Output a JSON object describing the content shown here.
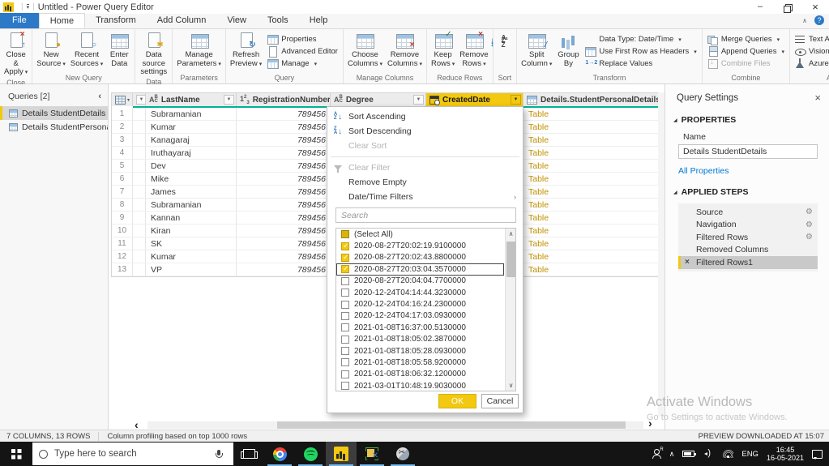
{
  "colors": {
    "accent": "#f2c811",
    "file_tab_blue": "#2b79c7",
    "quality_bar_teal": "#00b394",
    "table_value_amber": "#bf9000",
    "link_blue": "#0078d4"
  },
  "title_bar": {
    "title": "Untitled - Power Query Editor",
    "window_controls": [
      "minimize",
      "maximize",
      "close"
    ]
  },
  "tabs": [
    {
      "label": "File",
      "file": true
    },
    {
      "label": "Home",
      "active": true
    },
    {
      "label": "Transform"
    },
    {
      "label": "Add Column"
    },
    {
      "label": "View"
    },
    {
      "label": "Tools"
    },
    {
      "label": "Help"
    }
  ],
  "ribbon": {
    "groups": [
      {
        "label": "Close",
        "big": [
          {
            "label": "Close &\nApply",
            "icon": "close-apply",
            "dropdown": true
          }
        ]
      },
      {
        "label": "New Query",
        "big": [
          {
            "label": "New\nSource",
            "icon": "new-source",
            "dropdown": true
          },
          {
            "label": "Recent\nSources",
            "icon": "recent-sources",
            "dropdown": true
          },
          {
            "label": "Enter\nData",
            "icon": "enter-data"
          }
        ]
      },
      {
        "label": "Data Sources",
        "big": [
          {
            "label": "Data source\nsettings",
            "icon": "data-source-settings"
          }
        ]
      },
      {
        "label": "Parameters",
        "big": [
          {
            "label": "Manage\nParameters",
            "icon": "manage-parameters",
            "dropdown": true
          }
        ]
      },
      {
        "label": "Query",
        "big": [
          {
            "label": "Refresh\nPreview",
            "icon": "refresh-preview",
            "dropdown": true
          }
        ],
        "small": [
          {
            "label": "Properties",
            "icon": "properties"
          },
          {
            "label": "Advanced Editor",
            "icon": "advanced-editor"
          },
          {
            "label": "Manage",
            "icon": "manage",
            "dropdown": true
          }
        ]
      },
      {
        "label": "Manage Columns",
        "big": [
          {
            "label": "Choose\nColumns",
            "icon": "choose-columns",
            "dropdown": true
          },
          {
            "label": "Remove\nColumns",
            "icon": "remove-columns",
            "dropdown": true
          }
        ]
      },
      {
        "label": "Reduce Rows",
        "big": [
          {
            "label": "Keep\nRows",
            "icon": "keep-rows",
            "dropdown": true
          },
          {
            "label": "Remove\nRows",
            "icon": "remove-rows",
            "dropdown": true
          }
        ]
      },
      {
        "label": "Sort",
        "stack": [
          {
            "icon": "sort-ascending"
          },
          {
            "icon": "sort-descending"
          }
        ]
      },
      {
        "label": "Transform",
        "big": [
          {
            "label": "Split\nColumn",
            "icon": "split-column",
            "dropdown": true
          },
          {
            "label": "Group\nBy",
            "icon": "group-by"
          }
        ],
        "small": [
          {
            "label": "Data Type: Date/Time",
            "icon": "none",
            "dropdown": true
          },
          {
            "label": "Use First Row as Headers",
            "icon": "use-first-row",
            "dropdown": true
          },
          {
            "label": "Replace Values",
            "icon": "replace-values"
          }
        ]
      },
      {
        "label": "Combine",
        "small": [
          {
            "label": "Merge Queries",
            "icon": "merge-queries",
            "dropdown": true
          },
          {
            "label": "Append Queries",
            "icon": "append-queries",
            "dropdown": true
          },
          {
            "label": "Combine Files",
            "icon": "combine-files",
            "disabled": true
          }
        ]
      },
      {
        "label": "AI Insights",
        "small": [
          {
            "label": "Text Analytics",
            "icon": "text-analytics"
          },
          {
            "label": "Vision",
            "icon": "vision"
          },
          {
            "label": "Azure Machine Learning",
            "icon": "azure-ml"
          }
        ]
      }
    ]
  },
  "queries_panel": {
    "title": "Queries [2]",
    "items": [
      {
        "label": "Details StudentDetails",
        "selected": true
      },
      {
        "label": "Details StudentPersonal...",
        "selected": false
      }
    ]
  },
  "grid": {
    "columns": [
      {
        "header": "",
        "type": "corner"
      },
      {
        "header": "",
        "type": "filter-only"
      },
      {
        "header": "LastName",
        "type": "abc",
        "key": "lastName"
      },
      {
        "header": "RegistrationNumber",
        "type": "123",
        "key": "regNo",
        "align": "right"
      },
      {
        "header": "Degree",
        "type": "abc",
        "key": "degree"
      },
      {
        "header": "CreatedDate",
        "type": "datetime",
        "key": "createdDate",
        "selected": true
      },
      {
        "header": "Details.StudentPersonalDetails",
        "type": "table",
        "key": "details",
        "expand": true
      }
    ],
    "rows": [
      {
        "n": "1",
        "lastName": "Subramanian",
        "regNo": "789456",
        "details": "Table"
      },
      {
        "n": "2",
        "lastName": "Kumar",
        "regNo": "789456",
        "details": "Table"
      },
      {
        "n": "3",
        "lastName": "Kanagaraj",
        "regNo": "789456",
        "details": "Table"
      },
      {
        "n": "4",
        "lastName": "Iruthayaraj",
        "regNo": "789456",
        "details": "Table"
      },
      {
        "n": "5",
        "lastName": "Dev",
        "regNo": "789456",
        "details": "Table"
      },
      {
        "n": "6",
        "lastName": "Mike",
        "regNo": "789456",
        "details": "Table"
      },
      {
        "n": "7",
        "lastName": "James",
        "regNo": "789456",
        "details": "Table"
      },
      {
        "n": "8",
        "lastName": "Subramanian",
        "regNo": "789456",
        "details": "Table"
      },
      {
        "n": "9",
        "lastName": "Kannan",
        "regNo": "789456",
        "details": "Table"
      },
      {
        "n": "10",
        "lastName": "Kiran",
        "regNo": "789456",
        "details": "Table"
      },
      {
        "n": "11",
        "lastName": "SK",
        "regNo": "789456",
        "details": "Table"
      },
      {
        "n": "12",
        "lastName": "Kumar",
        "regNo": "789456",
        "details": "Table"
      },
      {
        "n": "13",
        "lastName": "VP",
        "regNo": "789456",
        "details": "Table"
      }
    ]
  },
  "filter_menu": {
    "items": [
      {
        "label": "Sort Ascending",
        "icon": "sort-ascending"
      },
      {
        "label": "Sort Descending",
        "icon": "sort-descending"
      },
      {
        "label": "Clear Sort",
        "disabled": true
      },
      {
        "divider": true
      },
      {
        "label": "Clear Filter",
        "icon": "clear-filter",
        "disabled": true
      },
      {
        "label": "Remove Empty"
      },
      {
        "label": "Date/Time Filters",
        "submenu": true
      }
    ],
    "search_placeholder": "Search",
    "select_all_label": "(Select All)",
    "select_all_state": "indeterminate",
    "values": [
      {
        "label": "2020-08-27T20:02:19.9100000",
        "checked": true
      },
      {
        "label": "2020-08-27T20:02:43.8800000",
        "checked": true
      },
      {
        "label": "2020-08-27T20:03:04.3570000",
        "checked": true,
        "focused": true
      },
      {
        "label": "2020-08-27T20:04:04.7700000",
        "checked": false
      },
      {
        "label": "2020-12-24T04:14:44.3230000",
        "checked": false
      },
      {
        "label": "2020-12-24T04:16:24.2300000",
        "checked": false
      },
      {
        "label": "2020-12-24T04:17:03.0930000",
        "checked": false
      },
      {
        "label": "2021-01-08T16:37:00.5130000",
        "checked": false
      },
      {
        "label": "2021-01-08T18:05:02.3870000",
        "checked": false
      },
      {
        "label": "2021-01-08T18:05:28.0930000",
        "checked": false
      },
      {
        "label": "2021-01-08T18:05:58.9200000",
        "checked": false
      },
      {
        "label": "2021-01-08T18:06:32.1200000",
        "checked": false
      },
      {
        "label": "2021-03-01T10:48:19.9030000",
        "checked": false
      }
    ],
    "ok_label": "OK",
    "cancel_label": "Cancel"
  },
  "query_settings": {
    "title": "Query Settings",
    "properties_header": "PROPERTIES",
    "name_label": "Name",
    "name_value": "Details StudentDetails",
    "all_properties_label": "All Properties",
    "applied_steps_header": "APPLIED STEPS",
    "steps": [
      {
        "label": "Source",
        "gear": true
      },
      {
        "label": "Navigation",
        "gear": true
      },
      {
        "label": "Filtered Rows",
        "gear": true
      },
      {
        "label": "Removed Columns"
      },
      {
        "label": "Filtered Rows1",
        "selected": true,
        "delete_icon": true
      }
    ]
  },
  "status_bar": {
    "left": "7 COLUMNS, 13 ROWS",
    "center": "Column profiling based on top 1000 rows",
    "right": "PREVIEW DOWNLOADED AT 15:07"
  },
  "watermark": {
    "line1": "Activate Windows",
    "line2": "Go to Settings to activate Windows."
  },
  "taskbar": {
    "search_placeholder": "Type here to search",
    "apps": [
      {
        "name": "task-view"
      },
      {
        "name": "chrome",
        "running": true
      },
      {
        "name": "spotify",
        "running": true
      },
      {
        "name": "power-bi",
        "running": true,
        "active": true
      },
      {
        "name": "screen-sketch",
        "running": true
      },
      {
        "name": "snipping-tool",
        "running": true
      }
    ],
    "tray_icons": [
      "people",
      "chevron-up",
      "battery",
      "volume",
      "wifi"
    ],
    "language": "ENG",
    "time": "16:45",
    "date": "16-05-2021"
  }
}
